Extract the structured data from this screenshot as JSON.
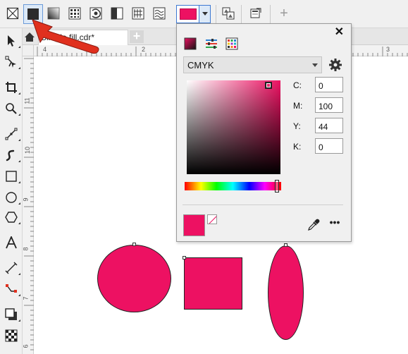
{
  "document": {
    "tab_title": "Simple fill.cdr*",
    "add_tab_label": "+"
  },
  "property_bar": {
    "fill_buttons": [
      {
        "name": "no-fill-icon"
      },
      {
        "name": "uniform-fill-icon",
        "selected": true
      },
      {
        "name": "fountain-fill-icon"
      },
      {
        "name": "vector-pattern-fill-icon"
      },
      {
        "name": "bitmap-pattern-fill-icon"
      },
      {
        "name": "two-color-pattern-fill-icon"
      },
      {
        "name": "texture-fill-icon"
      },
      {
        "name": "postscript-fill-icon"
      }
    ],
    "fill_color": "#ed1162",
    "add_label": "+"
  },
  "rulers": {
    "horizontal": [
      "4",
      "3",
      "2",
      "1",
      "2",
      "3"
    ],
    "vertical": [
      "11",
      "10",
      "9",
      "8",
      "7",
      "6"
    ]
  },
  "color_popup": {
    "close_label": "✕",
    "modes": [
      {
        "name": "color-viewers-icon"
      },
      {
        "name": "color-sliders-icon"
      },
      {
        "name": "color-palettes-icon"
      }
    ],
    "model": "CMYK",
    "components": [
      {
        "label": "C:",
        "value": "0"
      },
      {
        "label": "M:",
        "value": "100"
      },
      {
        "label": "Y:",
        "value": "44"
      },
      {
        "label": "K:",
        "value": "0"
      }
    ],
    "current_color": "#ed1162",
    "more_label": "•••"
  },
  "colors": {
    "accent": "#ed1162",
    "selection": "#3d78d2",
    "annotation_arrow": "#e0301e"
  },
  "shapes": [
    {
      "type": "ellipse",
      "fill": "#ed1162"
    },
    {
      "type": "rectangle",
      "fill": "#ed1162"
    },
    {
      "type": "ellipse",
      "fill": "#ed1162"
    }
  ]
}
